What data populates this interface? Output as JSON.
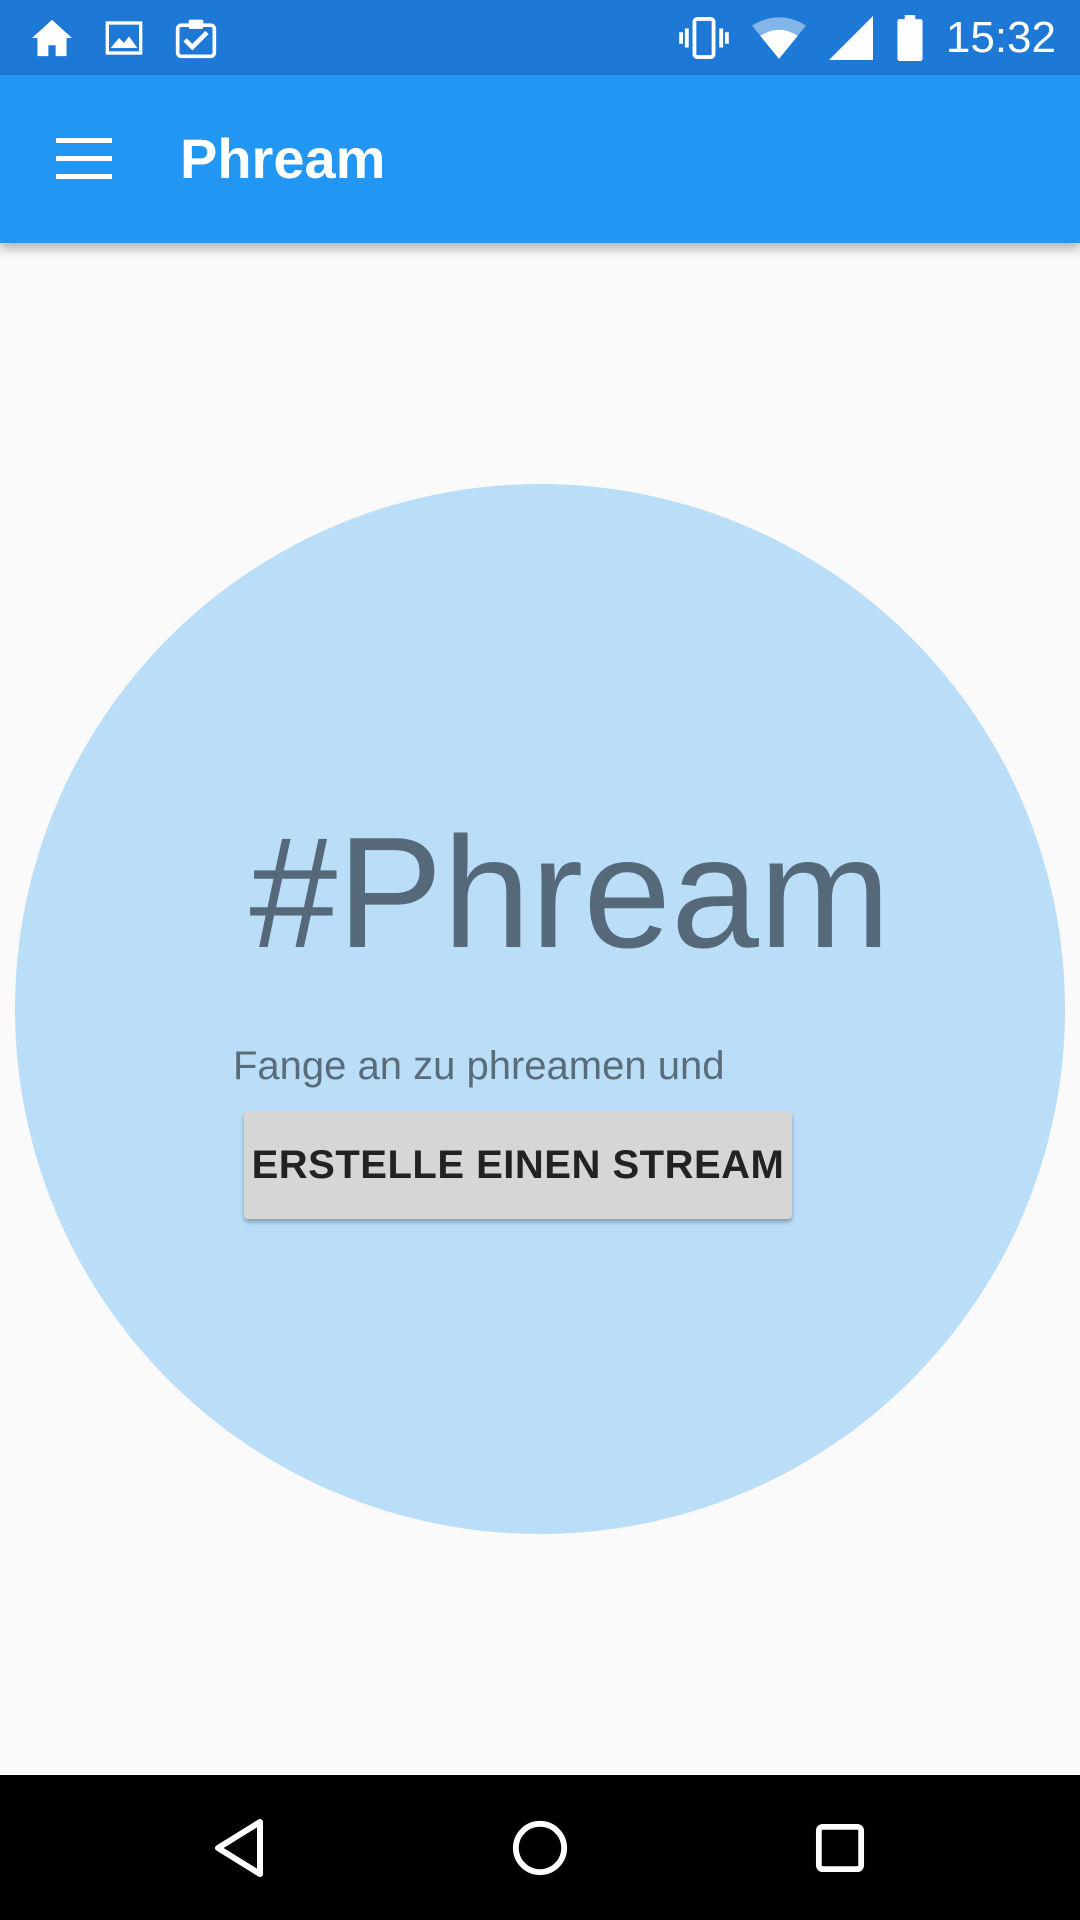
{
  "status_bar": {
    "time": "15:32",
    "left_icons": [
      "home-icon",
      "image-icon",
      "clipboard-check-icon"
    ],
    "right_icons": [
      "vibrate-icon",
      "wifi-icon",
      "signal-icon",
      "battery-icon"
    ],
    "background_color": "#1e79d6"
  },
  "app_bar": {
    "title": "Phream",
    "menu_icon": "hamburger-menu-icon",
    "background_color": "#2196f3"
  },
  "main": {
    "hero_title": "#Phream",
    "subtitle": "Fange an zu phreamen und",
    "create_button_label": "ERSTELLE EINEN STREAM",
    "circle_color": "#bbdef8"
  },
  "nav_bar": {
    "buttons": [
      "back-icon",
      "home-circle-icon",
      "recents-icon"
    ]
  }
}
